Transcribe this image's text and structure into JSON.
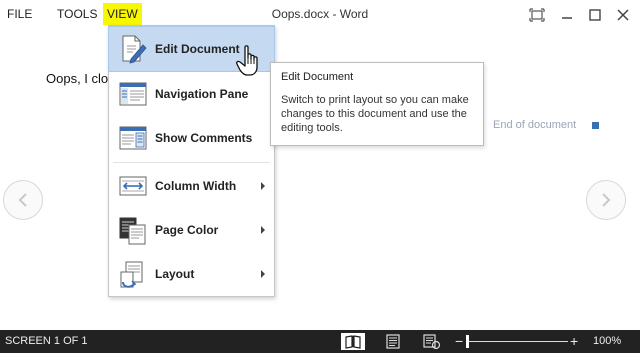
{
  "menu": {
    "file": "FILE",
    "tools": "TOOLS",
    "view": "VIEW"
  },
  "document": {
    "title": "Oops.docx - Word",
    "body_text": "Oops, I clo",
    "end_marker": "End of document"
  },
  "view_menu": {
    "items": [
      {
        "label": "Edit Document",
        "icon": "edit-document-icon",
        "submenu": false
      },
      {
        "label": "Navigation Pane",
        "icon": "navigation-pane-icon",
        "submenu": false
      },
      {
        "label": "Show Comments",
        "icon": "show-comments-icon",
        "submenu": false
      },
      {
        "label": "Column Width",
        "icon": "column-width-icon",
        "submenu": true
      },
      {
        "label": "Page Color",
        "icon": "page-color-icon",
        "submenu": true
      },
      {
        "label": "Layout",
        "icon": "layout-icon",
        "submenu": true
      }
    ]
  },
  "tooltip": {
    "title": "Edit Document",
    "description": "Switch to print layout so you can make changes to this document and use the editing tools."
  },
  "status": {
    "screen": "SCREEN 1 OF 1",
    "zoom": "100%"
  },
  "colors": {
    "view_highlight": "#f7f700",
    "menu_hover": "#c5daf1",
    "status_bar": "#222222",
    "end_marker": "#3c6eb4"
  }
}
